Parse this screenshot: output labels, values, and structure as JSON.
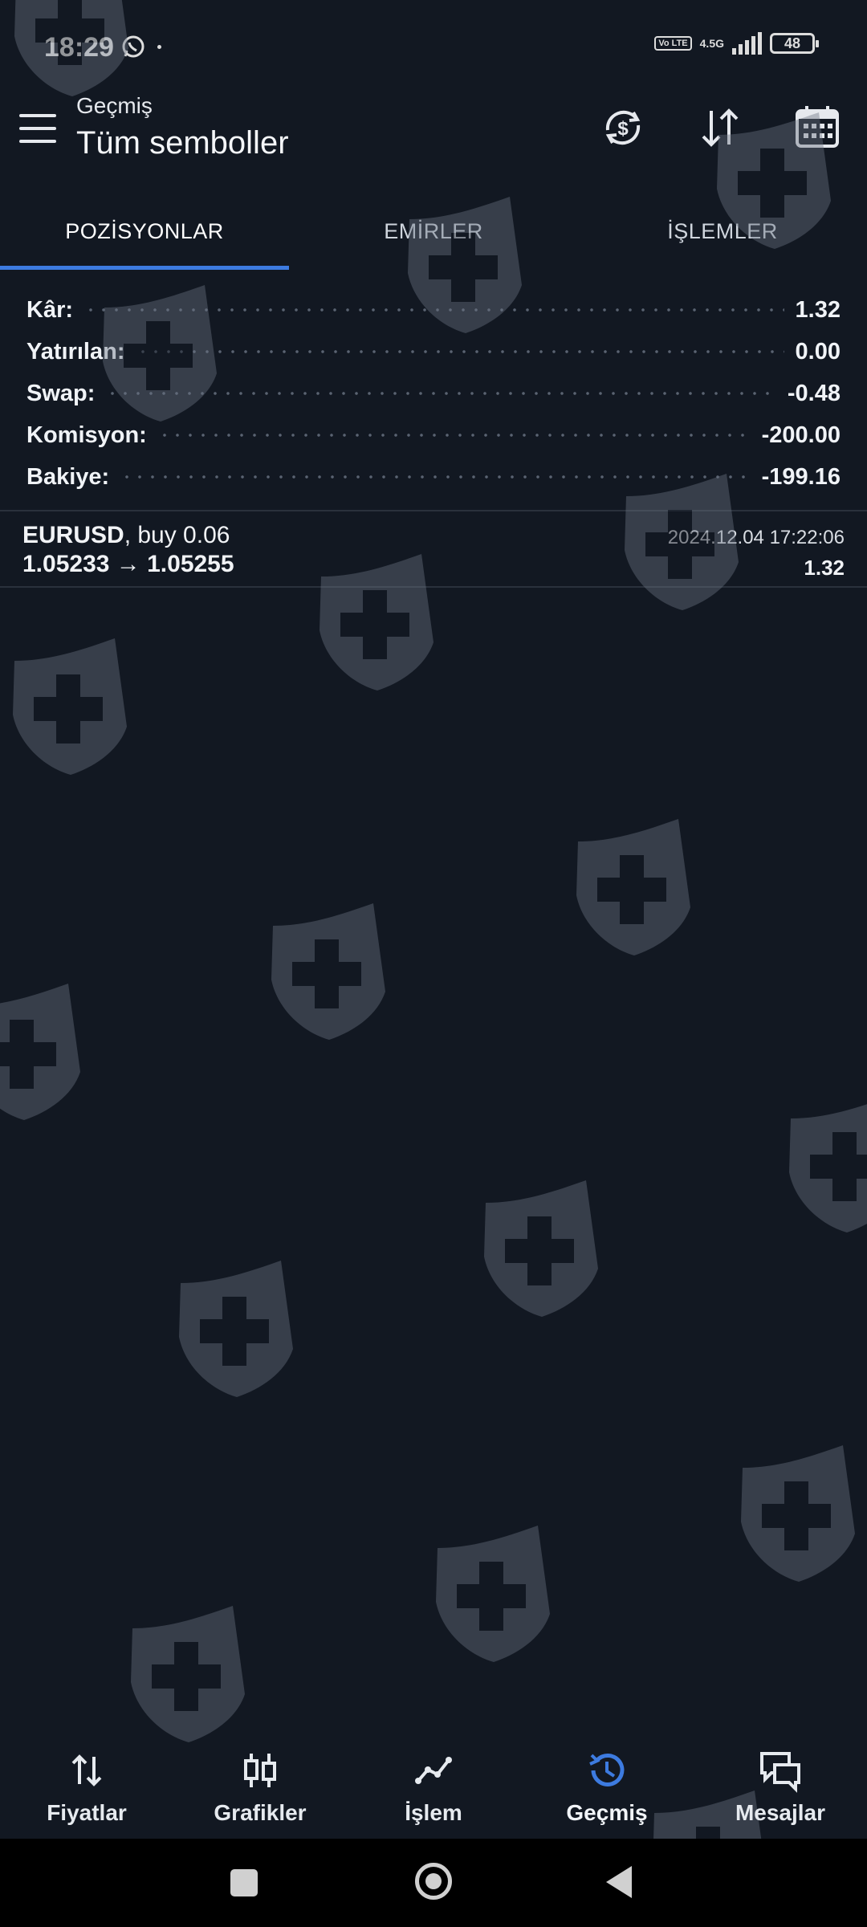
{
  "status_bar": {
    "time": "18:29",
    "volte": "Vo LTE",
    "network": "4.5G",
    "battery": "48"
  },
  "header": {
    "subtitle": "Geçmiş",
    "title": "Tüm semboller"
  },
  "tabs": [
    {
      "label": "POZİSYONLAR",
      "active": true
    },
    {
      "label": "EMİRLER",
      "active": false
    },
    {
      "label": "İŞLEMLER",
      "active": false
    }
  ],
  "summary": [
    {
      "label": "Kâr:",
      "value": "1.32"
    },
    {
      "label": "Yatırılan:",
      "value": "0.00"
    },
    {
      "label": "Swap:",
      "value": "-0.48"
    },
    {
      "label": "Komisyon:",
      "value": "-200.00"
    },
    {
      "label": "Bakiye:",
      "value": "-199.16"
    }
  ],
  "positions": [
    {
      "symbol": "EURUSD",
      "side": ", buy 0.06",
      "prices": "1.05233 → 1.05255",
      "date": "2024.12.04 17:22:06",
      "profit": "1.32"
    }
  ],
  "bottom_nav": [
    {
      "label": "Fiyatlar",
      "icon": "arrows-up-down-icon"
    },
    {
      "label": "Grafikler",
      "icon": "candlestick-icon"
    },
    {
      "label": "İşlem",
      "icon": "trade-line-icon"
    },
    {
      "label": "Geçmiş",
      "icon": "history-icon",
      "active": true
    },
    {
      "label": "Mesajlar",
      "icon": "chat-icon"
    }
  ],
  "colors": {
    "background": "#121822",
    "accent": "#3d7be0",
    "text": "#f0f3f7"
  }
}
